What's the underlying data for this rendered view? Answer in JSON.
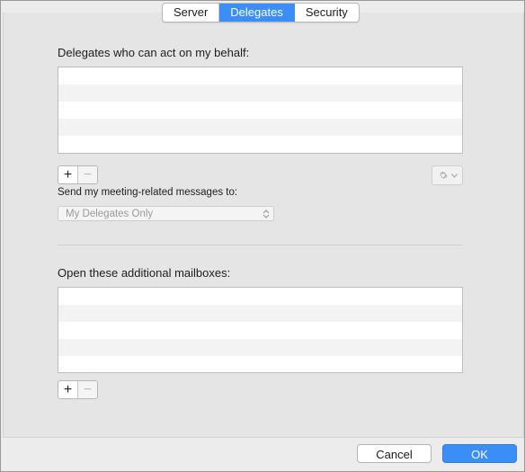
{
  "tabs": [
    {
      "label": "Server",
      "active": false
    },
    {
      "label": "Delegates",
      "active": true
    },
    {
      "label": "Security",
      "active": false
    }
  ],
  "delegates": {
    "heading": "Delegates who can act on my behalf:",
    "add_label": "+",
    "remove_label": "−",
    "send_label": "Send my meeting-related messages to:",
    "send_value": "My Delegates Only",
    "gear_icon": "gear-icon"
  },
  "mailboxes": {
    "heading": "Open these additional mailboxes:",
    "add_label": "+",
    "remove_label": "−"
  },
  "buttons": {
    "cancel": "Cancel",
    "ok": "OK"
  },
  "colors": {
    "accent": "#3a8ef6"
  }
}
